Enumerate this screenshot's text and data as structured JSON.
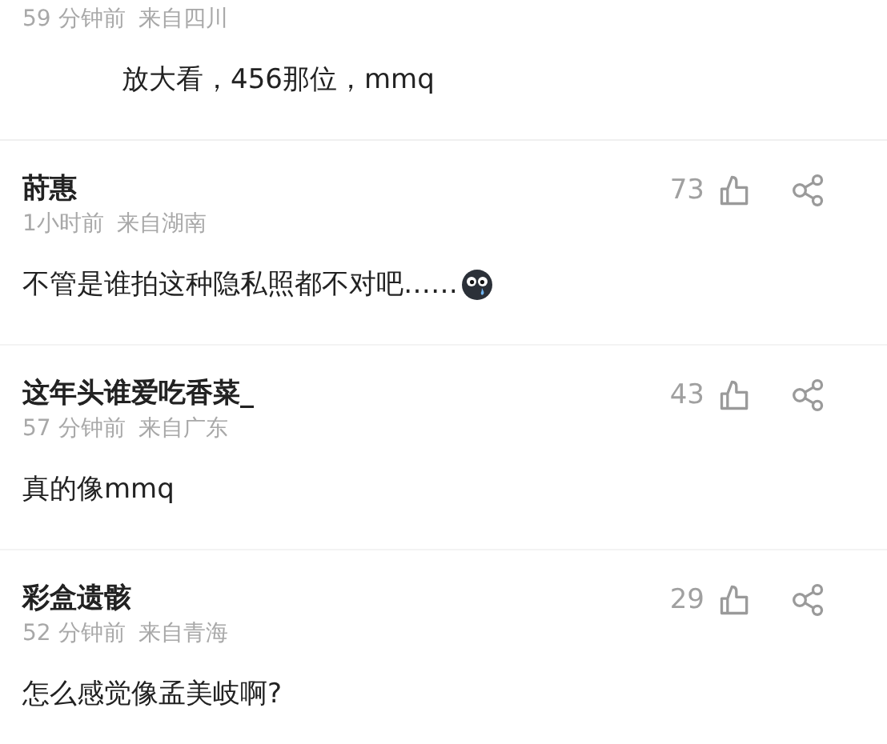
{
  "top_reply": {
    "time": "59 分钟前",
    "location": "来自四川",
    "text": "放大看，456那位，mmq"
  },
  "comments": [
    {
      "author": "莳惠",
      "time": "1小时前",
      "location": "来自湖南",
      "likes": "73",
      "text": "不管是谁拍这种隐私照都不对吧……",
      "has_emoji": true
    },
    {
      "author": "这年头谁爱吃香菜_",
      "time": "57 分钟前",
      "location": "来自广东",
      "likes": "43",
      "text": "真的像mmq",
      "has_emoji": false
    },
    {
      "author": "彩盒遗骸",
      "time": "52 分钟前",
      "location": "来自青海",
      "likes": "29",
      "text": "怎么感觉像孟美岐啊?",
      "has_emoji": false
    }
  ]
}
